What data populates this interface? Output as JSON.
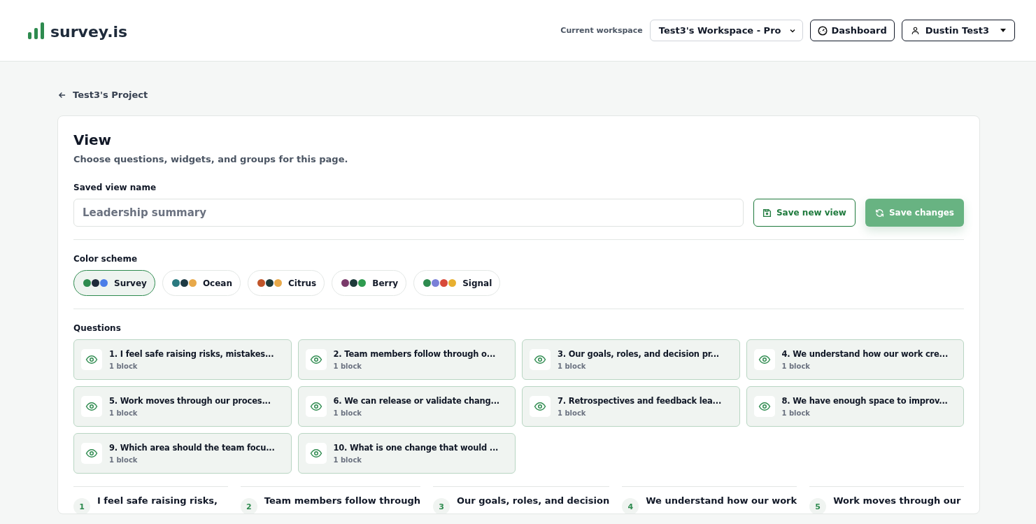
{
  "header": {
    "logo": "survey.is",
    "workspace_label": "Current workspace",
    "workspace": "Test3's Workspace - Pro",
    "dashboard": "Dashboard",
    "user": "Dustin Test3"
  },
  "back_link": "Test3's Project",
  "view": {
    "title": "View",
    "subtitle": "Choose questions, widgets, and groups for this page.",
    "name_label": "Saved view name",
    "name_value": "Leadership summary",
    "save_new": "Save new view",
    "save_changes": "Save changes"
  },
  "color_scheme": {
    "label": "Color scheme",
    "schemes": [
      {
        "name": "Survey",
        "selected": true,
        "dots": [
          {
            "color": "#2e8b4f"
          },
          {
            "color": "#1e2a3a"
          },
          {
            "color": "#4a7de8"
          }
        ]
      },
      {
        "name": "Ocean",
        "selected": false,
        "dots": [
          {
            "color": "#2a7a80"
          },
          {
            "color": "#1e3a44"
          },
          {
            "color": "#e8a94a"
          }
        ]
      },
      {
        "name": "Citrus",
        "selected": false,
        "dots": [
          {
            "color": "#c0552a"
          },
          {
            "color": "#1e3a3a"
          },
          {
            "color": "#e8a94a"
          }
        ]
      },
      {
        "name": "Berry",
        "selected": false,
        "dots": [
          {
            "color": "#7a3a6a"
          },
          {
            "color": "#1e3a3a"
          },
          {
            "color": "#2e9b4f"
          }
        ]
      },
      {
        "name": "Signal",
        "selected": false,
        "dots": [
          {
            "color": "#2e8b4f"
          },
          {
            "color": "#7a80d8"
          },
          {
            "color": "#d84a3a"
          },
          {
            "color": "#e8b030"
          }
        ]
      }
    ]
  },
  "questions": {
    "label": "Questions",
    "items": [
      {
        "title": "1. I feel safe raising risks, mistakes...",
        "blocks": "1 block",
        "visible": true
      },
      {
        "title": "2. Team members follow through o...",
        "blocks": "1 block",
        "visible": true
      },
      {
        "title": "3. Our goals, roles, and decision pr...",
        "blocks": "1 block",
        "visible": true
      },
      {
        "title": "4. We understand how our work cre...",
        "blocks": "1 block",
        "visible": true
      },
      {
        "title": "5. Work moves through our proces...",
        "blocks": "1 block",
        "visible": true
      },
      {
        "title": "6. We can release or validate chang...",
        "blocks": "1 block",
        "visible": true
      },
      {
        "title": "7. Retrospectives and feedback lea...",
        "blocks": "1 block",
        "visible": true
      },
      {
        "title": "8. We have enough space to improv...",
        "blocks": "1 block",
        "visible": true
      },
      {
        "title": "9. Which area should the team focu...",
        "blocks": "1 block",
        "visible": true
      },
      {
        "title": "10. What is one change that would ...",
        "blocks": "1 block",
        "visible": true
      }
    ]
  },
  "preview_cards": [
    {
      "number": "1",
      "text": "I feel safe raising risks,"
    },
    {
      "number": "2",
      "text": "Team members follow through"
    },
    {
      "number": "3",
      "text": "Our goals, roles, and decision"
    },
    {
      "number": "4",
      "text": "We understand how our work"
    },
    {
      "number": "5",
      "text": "Work moves through our"
    }
  ]
}
